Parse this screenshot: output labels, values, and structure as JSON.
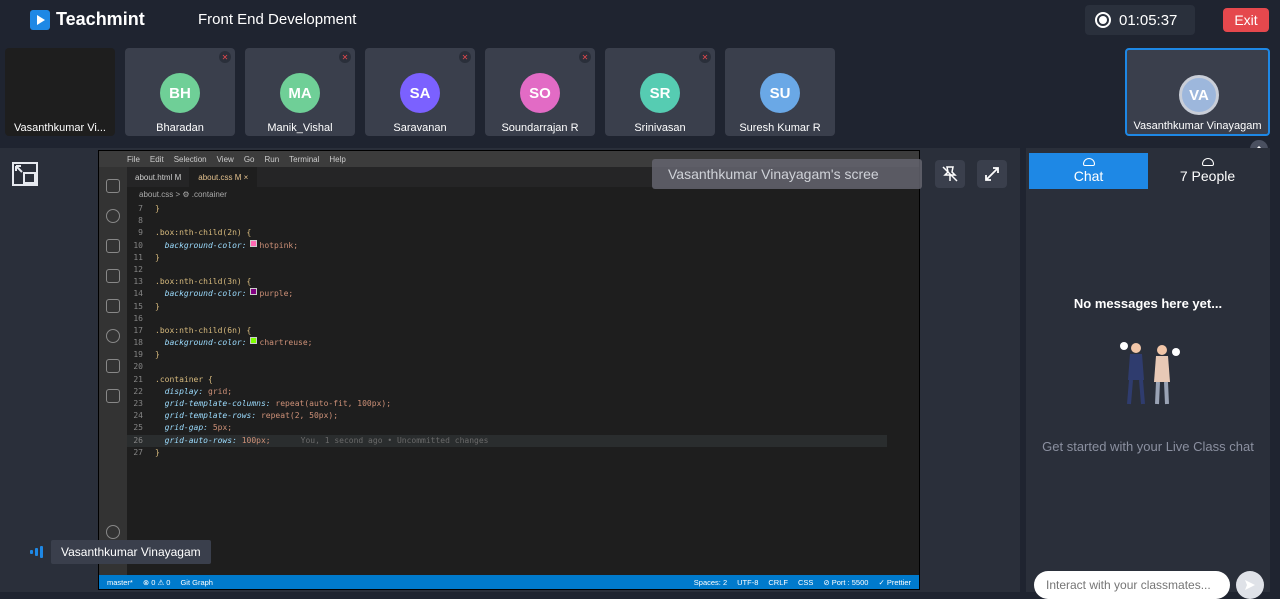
{
  "app": {
    "brand": "Teachmint",
    "class_title": "Front End Development"
  },
  "recording": {
    "timer": "01:05:37"
  },
  "header": {
    "exit_label": "Exit"
  },
  "participants": [
    {
      "initials": "",
      "name": "Vasanthkumar Vi...",
      "color": "",
      "muted": false,
      "screen": true
    },
    {
      "initials": "BH",
      "name": "Bharadan",
      "color": "#6fcf97",
      "muted": true
    },
    {
      "initials": "MA",
      "name": "Manik_Vishal",
      "color": "#6fcf97",
      "muted": true
    },
    {
      "initials": "SA",
      "name": "Saravanan",
      "color": "#7b61ff",
      "muted": true
    },
    {
      "initials": "SO",
      "name": "Soundarrajan R",
      "color": "#e26bc5",
      "muted": true
    },
    {
      "initials": "SR",
      "name": "Srinivasan",
      "color": "#56ccb2",
      "muted": true
    },
    {
      "initials": "SU",
      "name": "Suresh Kumar R",
      "color": "#6aa8e6",
      "muted": false
    },
    {
      "initials": "VA",
      "name": "Vasanthkumar Vinayagam",
      "color": "#9db7dc",
      "muted": false
    }
  ],
  "screen_share": {
    "caption": "Vasanthkumar Vinayagam's scree",
    "editor": {
      "menu": [
        "File",
        "Edit",
        "Selection",
        "View",
        "Go",
        "Run",
        "Terminal",
        "Help"
      ],
      "tabs": [
        {
          "label": "about.html  M",
          "active": false
        },
        {
          "label": "about.css  M  ×",
          "active": true
        }
      ],
      "breadcrumb": "about.css > ⚙ .container",
      "lines": [
        {
          "n": "7",
          "t": "}"
        },
        {
          "n": "8",
          "t": ""
        },
        {
          "n": "9",
          "t": ".box:nth-child(2n) {"
        },
        {
          "n": "10",
          "t": "  background-color:",
          "v": "hotpink;",
          "swatch": "#ff69b4"
        },
        {
          "n": "11",
          "t": "}"
        },
        {
          "n": "12",
          "t": ""
        },
        {
          "n": "13",
          "t": ".box:nth-child(3n) {"
        },
        {
          "n": "14",
          "t": "  background-color:",
          "v": "purple;",
          "swatch": "#800080"
        },
        {
          "n": "15",
          "t": "}"
        },
        {
          "n": "16",
          "t": ""
        },
        {
          "n": "17",
          "t": ".box:nth-child(6n) {"
        },
        {
          "n": "18",
          "t": "  background-color:",
          "v": "chartreuse;",
          "swatch": "#7fff00"
        },
        {
          "n": "19",
          "t": "}"
        },
        {
          "n": "20",
          "t": ""
        },
        {
          "n": "21",
          "t": ".container {"
        },
        {
          "n": "22",
          "t": "  display:",
          "v": "grid;"
        },
        {
          "n": "23",
          "t": "  grid-template-columns:",
          "v": "repeat(auto-fit, 100px);"
        },
        {
          "n": "24",
          "t": "  grid-template-rows:",
          "v": "repeat(2, 50px);"
        },
        {
          "n": "25",
          "t": "  grid-gap:",
          "v": "5px;"
        },
        {
          "n": "26",
          "t": "  grid-auto-rows:",
          "v": "100px;",
          "ghost": "You, 1 second ago • Uncommitted changes",
          "hl": true
        },
        {
          "n": "27",
          "t": "}"
        }
      ],
      "status_left": [
        "master*",
        "⊗ 0 ⚠ 0",
        "Git Graph"
      ],
      "status_right": [
        "Spaces: 2",
        "UTF-8",
        "CRLF",
        "CSS",
        "⊘ Port : 5500",
        "✓ Prettier"
      ]
    }
  },
  "speaker": {
    "name": "Vasanthkumar Vinayagam"
  },
  "panel": {
    "tab_chat": "Chat",
    "tab_people": "7 People",
    "empty_title": "No messages here yet...",
    "empty_hint": "Get started with your Live Class chat",
    "input_placeholder": "Interact with your classmates..."
  },
  "colors": {
    "accent": "#1e88e5",
    "background": "#1f2430",
    "exit": "#e5484d"
  }
}
